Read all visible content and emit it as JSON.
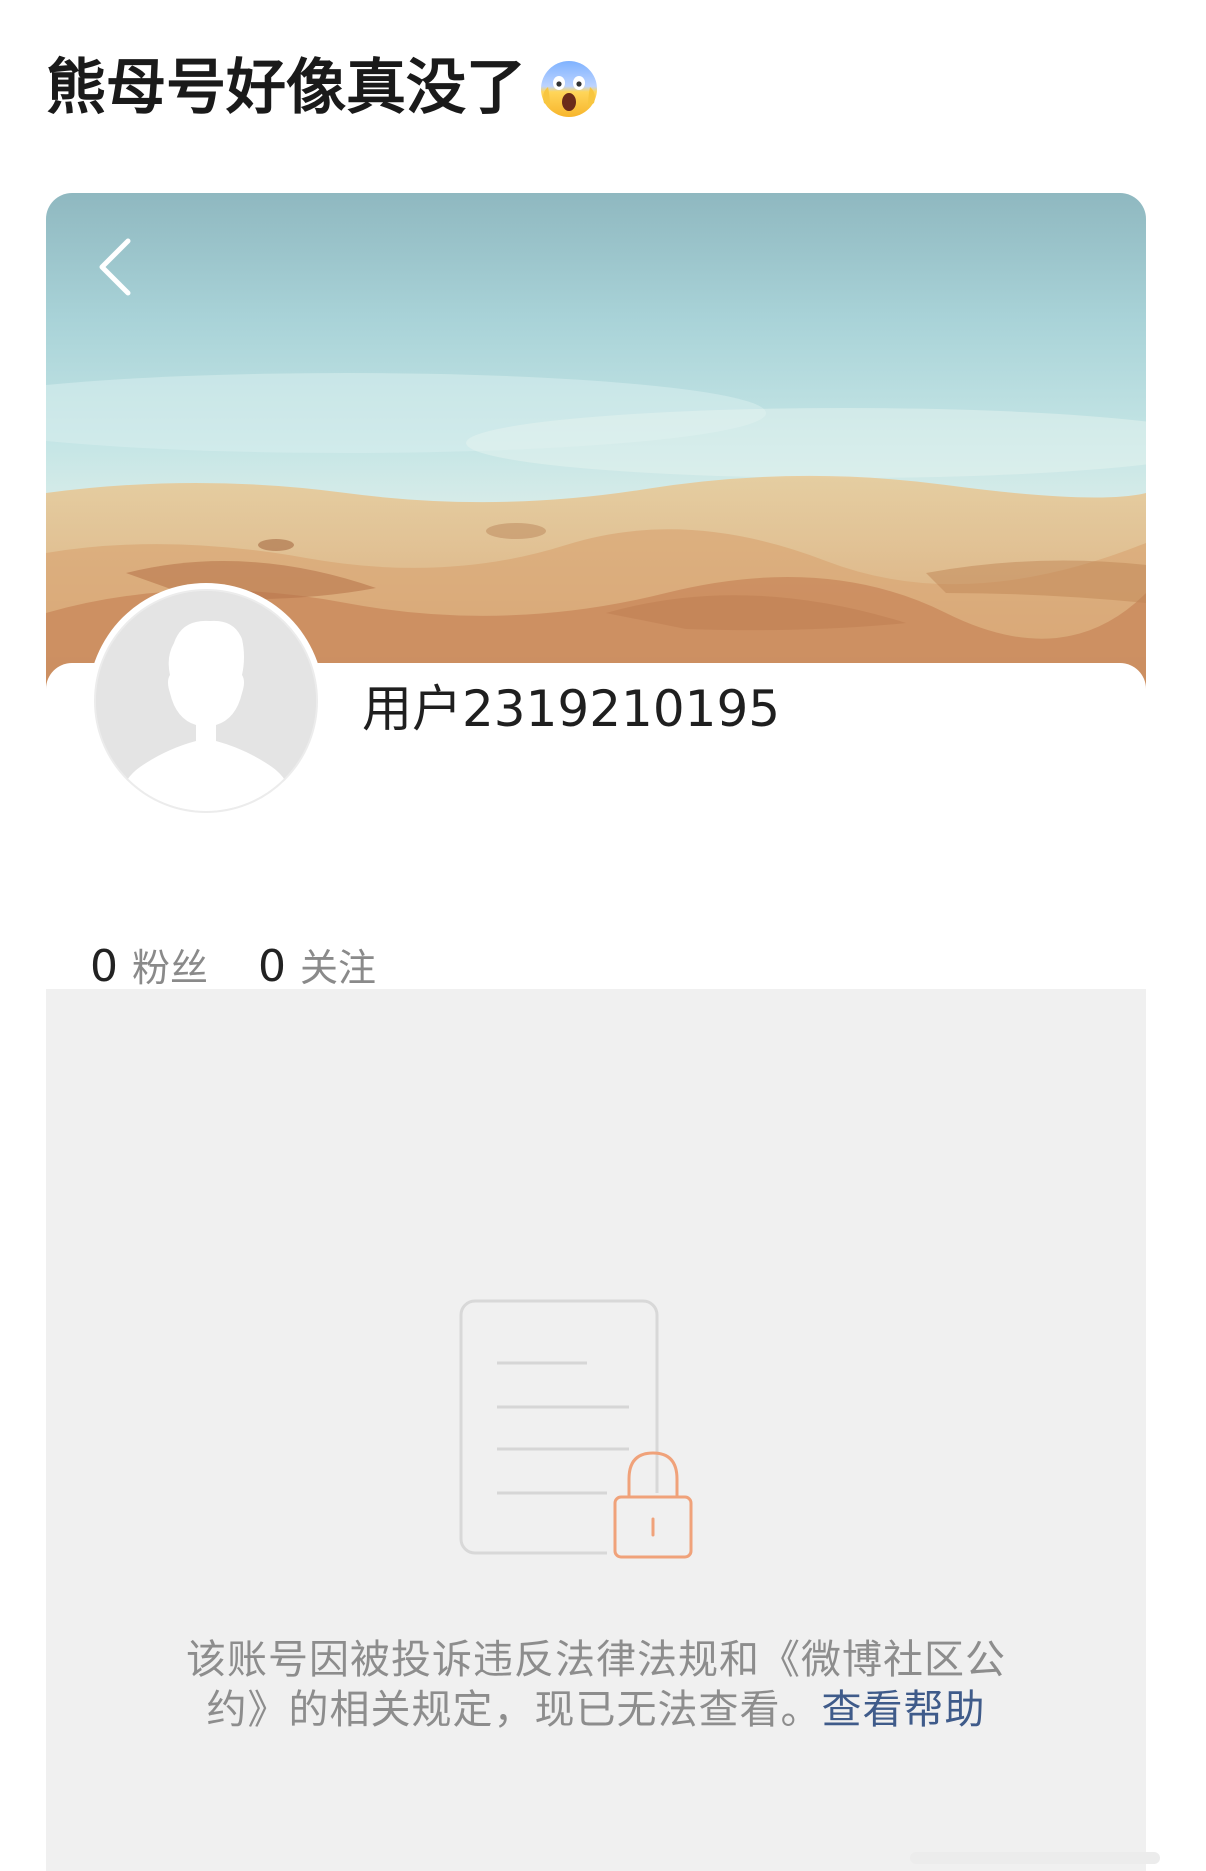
{
  "post": {
    "title": "熊母号好像真没了",
    "emoji": "face-screaming-in-fear-emoji"
  },
  "profile": {
    "back_icon": "chevron-left-icon",
    "avatar_icon": "default-avatar-silhouette-icon",
    "username": "用户2319210195",
    "stats": [
      {
        "count": "0",
        "label": "粉丝"
      },
      {
        "count": "0",
        "label": "关注"
      }
    ]
  },
  "notice": {
    "icon": "locked-document-icon",
    "text": "该账号因被投诉违反法律法规和《微博社区公约》的相关规定，现已无法查看。",
    "link": "查看帮助"
  },
  "colors": {
    "link": "#3f5b8a",
    "lock": "#f0a27a",
    "content_bg": "#f0f0f0"
  }
}
